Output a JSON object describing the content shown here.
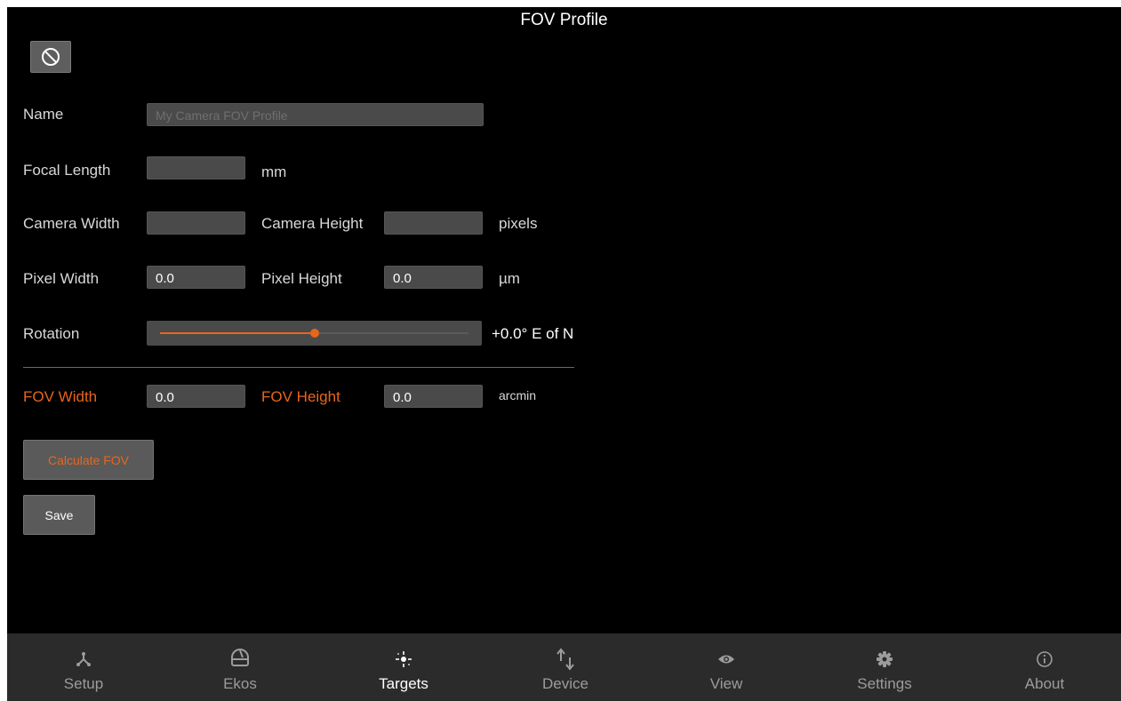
{
  "header": {
    "title": "FOV Profile"
  },
  "form": {
    "name": {
      "label": "Name",
      "placeholder": "My Camera FOV Profile",
      "value": ""
    },
    "focal_length": {
      "label": "Focal Length",
      "value": "",
      "unit": "mm"
    },
    "camera_width": {
      "label": "Camera Width",
      "value": ""
    },
    "camera_height": {
      "label": "Camera Height",
      "value": "",
      "unit": "pixels"
    },
    "pixel_width": {
      "label": "Pixel Width",
      "value": "0.0"
    },
    "pixel_height": {
      "label": "Pixel Height",
      "value": "0.0",
      "unit": "µm"
    },
    "rotation": {
      "label": "Rotation",
      "readout": "+0.0° E of N",
      "level": 0.5
    },
    "fov_width": {
      "label": "FOV Width",
      "value": "0.0"
    },
    "fov_height": {
      "label": "FOV Height",
      "value": "0.0",
      "unit": "arcmin"
    }
  },
  "buttons": {
    "calculate": "Calculate FOV",
    "save": "Save",
    "cancel_icon": "cancel-icon"
  },
  "nav": {
    "items": [
      {
        "label": "Setup",
        "icon": "setup-icon"
      },
      {
        "label": "Ekos",
        "icon": "ekos-icon"
      },
      {
        "label": "Targets",
        "icon": "targets-icon",
        "active": true
      },
      {
        "label": "Device",
        "icon": "device-icon"
      },
      {
        "label": "View",
        "icon": "eye-icon"
      },
      {
        "label": "Settings",
        "icon": "gear-icon"
      },
      {
        "label": "About",
        "icon": "info-icon"
      }
    ]
  },
  "colors": {
    "accent": "#e8661c",
    "background": "#000000",
    "navbar": "#2b2b2b",
    "field": "#4a4a4a"
  }
}
